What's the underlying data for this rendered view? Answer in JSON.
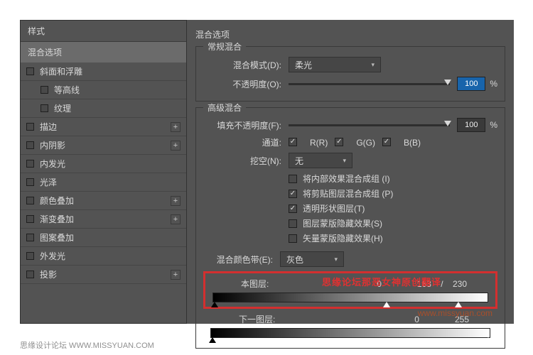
{
  "sidebar": {
    "header": "样式",
    "selected": "混合选项",
    "items": [
      {
        "label": "斜面和浮雕",
        "add": false,
        "indent": false
      },
      {
        "label": "等高线",
        "add": false,
        "indent": true
      },
      {
        "label": "纹理",
        "add": false,
        "indent": true
      },
      {
        "label": "描边",
        "add": true,
        "indent": false
      },
      {
        "label": "内阴影",
        "add": true,
        "indent": false
      },
      {
        "label": "内发光",
        "add": false,
        "indent": false
      },
      {
        "label": "光泽",
        "add": false,
        "indent": false
      },
      {
        "label": "颜色叠加",
        "add": true,
        "indent": false
      },
      {
        "label": "渐变叠加",
        "add": true,
        "indent": false
      },
      {
        "label": "图案叠加",
        "add": false,
        "indent": false
      },
      {
        "label": "外发光",
        "add": false,
        "indent": false
      },
      {
        "label": "投影",
        "add": true,
        "indent": false
      }
    ]
  },
  "main": {
    "title": "混合选项",
    "general": {
      "group_label": "常规混合",
      "mode_label": "混合模式(D):",
      "mode_value": "柔光",
      "opacity_label": "不透明度(O):",
      "opacity_value": "100",
      "pct": "%"
    },
    "advanced": {
      "group_label": "高级混合",
      "fill_label": "填充不透明度(F):",
      "fill_value": "100",
      "channel_label": "通道:",
      "channel_r": "R(R)",
      "channel_g": "G(G)",
      "channel_b": "B(B)",
      "knockout_label": "挖空(N):",
      "knockout_value": "无",
      "options": [
        {
          "label": "将内部效果混合成组 (I)",
          "checked": false
        },
        {
          "label": "将剪贴图层混合成组 (P)",
          "checked": true
        },
        {
          "label": "透明形状图层(T)",
          "checked": true
        },
        {
          "label": "图层蒙版隐藏效果(S)",
          "checked": false
        },
        {
          "label": "矢量蒙版隐藏效果(H)",
          "checked": false
        }
      ]
    },
    "blend_if": {
      "label": "混合颜色带(E):",
      "value": "灰色",
      "this_layer": {
        "label": "本图层:",
        "low": "0",
        "high_a": "163",
        "sep": "/",
        "high_b": "230"
      },
      "underlying": {
        "label": "下一图层:",
        "low": "0",
        "high": "255"
      }
    }
  },
  "overlay": {
    "red_text": "思缘论坛那恶女神原创翻译",
    "url": "www.missyuan.com"
  },
  "footer": "思缘设计论坛 WWW.MISSYUAN.COM"
}
